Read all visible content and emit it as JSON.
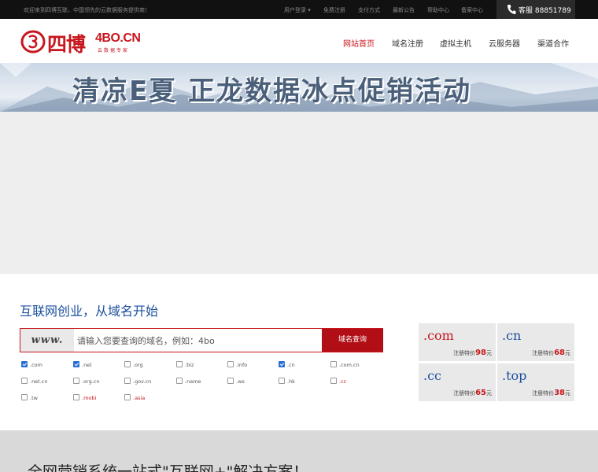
{
  "topbar": {
    "welcome": "欢迎来到四博互联，中国领先的云数据服务提供商！",
    "nav": [
      "用户登录",
      "免费注册",
      "支付方式",
      "最新公告",
      "帮助中心",
      "备案中心"
    ],
    "hotline_label": "客服",
    "hotline_number": "88851789"
  },
  "logo": {
    "cn": "四博",
    "en": "4BO.CN",
    "sub": "云数据专家"
  },
  "main_nav": [
    "网站首页",
    "域名注册",
    "虚拟主机",
    "云服务器",
    "渠道合作"
  ],
  "banner": {
    "title": "清凉E夏  正龙数据冰点促销活动"
  },
  "domain": {
    "heading": "互联网创业，从域名开始",
    "www_label": "www.",
    "placeholder": "请输入您要查询的域名，例如：4bo",
    "search_button": "域名查询",
    "tlds": [
      {
        "name": ".com",
        "checked": true,
        "red": false
      },
      {
        "name": ".net",
        "checked": true,
        "red": false
      },
      {
        "name": ".org",
        "checked": false,
        "red": false
      },
      {
        "name": ".biz",
        "checked": false,
        "red": false
      },
      {
        "name": ".info",
        "checked": false,
        "red": false
      },
      {
        "name": ".cn",
        "checked": true,
        "red": false
      },
      {
        "name": ".com.cn",
        "checked": false,
        "red": false
      },
      {
        "name": ".net.cn",
        "checked": false,
        "red": false
      },
      {
        "name": ".org.cn",
        "checked": false,
        "red": false
      },
      {
        "name": ".gov.cn",
        "checked": false,
        "red": false
      },
      {
        "name": ".name",
        "checked": false,
        "red": false
      },
      {
        "name": ".ws",
        "checked": false,
        "red": false
      },
      {
        "name": ".hk",
        "checked": false,
        "red": false
      },
      {
        "name": ".cc",
        "checked": false,
        "red": true
      },
      {
        "name": ".tw",
        "checked": false,
        "red": false
      },
      {
        "name": ".mobi",
        "checked": false,
        "red": true
      },
      {
        "name": ".asia",
        "checked": false,
        "red": true
      }
    ],
    "prices": [
      {
        "ext": ".com",
        "label": "注册特价",
        "price": "98",
        "unit": "元",
        "color": "#c8161d"
      },
      {
        "ext": ".cn",
        "label": "注册特价",
        "price": "68",
        "unit": "元",
        "color": "#1a4f9c"
      },
      {
        "ext": ".cc",
        "label": "注册特价",
        "price": "65",
        "unit": "元",
        "color": "#1a4f9c"
      },
      {
        "ext": ".top",
        "label": "注册特价",
        "price": "38",
        "unit": "元",
        "color": "#1a4f9c"
      }
    ]
  },
  "bottom": {
    "slogan": "全网营销系统一站式\"互联网+\"解决方案！"
  },
  "colors": {
    "brand_red": "#c8161d",
    "heading_blue": "#1a4f9c",
    "topbar_bg": "#111111"
  }
}
